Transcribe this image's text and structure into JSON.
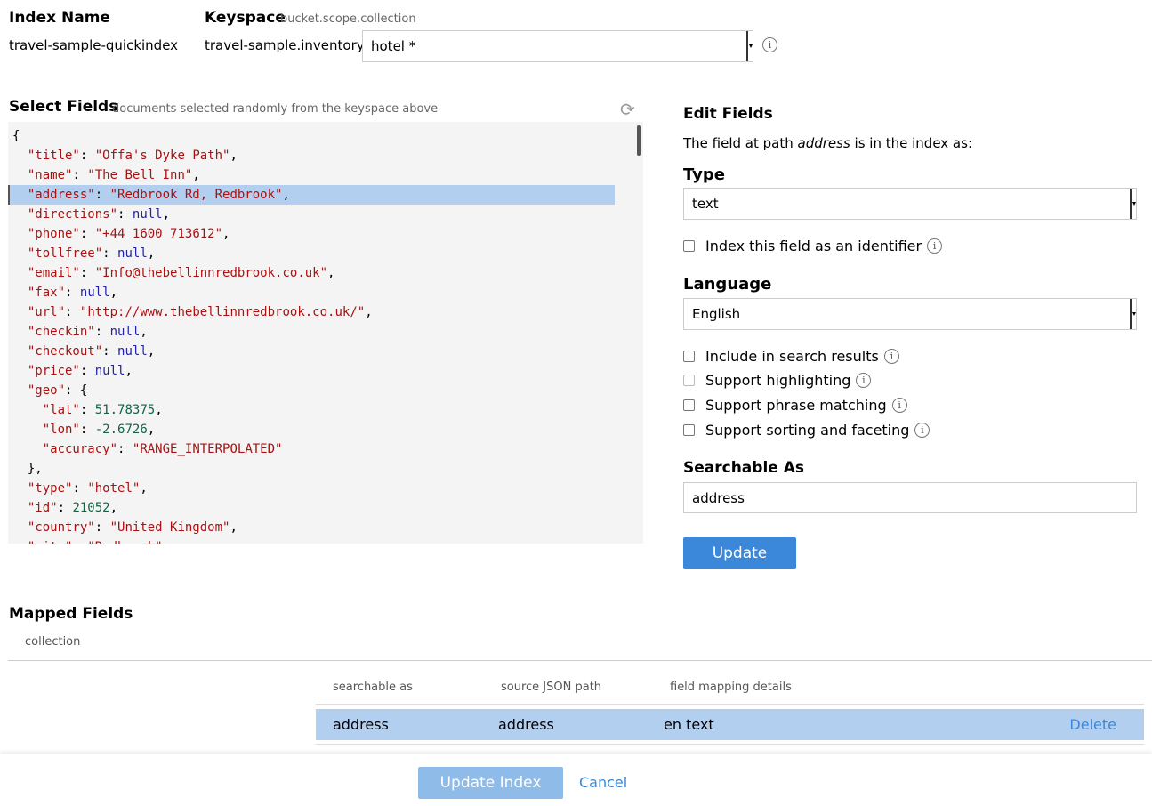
{
  "header": {
    "index_name_label": "Index Name",
    "index_name_value": "travel-sample-quickindex",
    "keyspace_label": "Keyspace",
    "keyspace_hint": "bucket.scope.collection",
    "keyspace_prefix": "travel-sample.inventory.",
    "keyspace_selected": "hotel *",
    "info_icon": "info-icon"
  },
  "select_fields": {
    "title": "Select Fields",
    "hint": "documents selected randomly from the keyspace above",
    "refresh_icon": "refresh-icon",
    "json_lines": [
      "{",
      "  \"title\": \"Offa's Dyke Path\",",
      "  \"name\": \"The Bell Inn\",",
      "  \"address\": \"Redbrook Rd, Redbrook\",",
      "  \"directions\": null,",
      "  \"phone\": \"+44 1600 713612\",",
      "  \"tollfree\": null,",
      "  \"email\": \"Info@thebellinnredbrook.co.uk\",",
      "  \"fax\": null,",
      "  \"url\": \"http://www.thebellinnredbrook.co.uk/\",",
      "  \"checkin\": null,",
      "  \"checkout\": null,",
      "  \"price\": null,",
      "  \"geo\": {",
      "    \"lat\": 51.78375,",
      "    \"lon\": -2.6726,",
      "    \"accuracy\": \"RANGE_INTERPOLATED\"",
      "  },",
      "  \"type\": \"hotel\",",
      "  \"id\": 21052,",
      "  \"country\": \"United Kingdom\",",
      "  \"city\": \"Redbrook\","
    ],
    "highlighted_line": 3
  },
  "edit_fields": {
    "title": "Edit Fields",
    "desc_prefix": "The field at path ",
    "desc_path": "address",
    "desc_suffix": " is in the index as:",
    "type_label": "Type",
    "type_value": "text",
    "identifier_label": "Index this field as an identifier",
    "language_label": "Language",
    "language_value": "English",
    "options": [
      {
        "label": "Include in search results",
        "checked": false
      },
      {
        "label": "Support highlighting",
        "checked": false
      },
      {
        "label": "Support phrase matching",
        "checked": false
      },
      {
        "label": "Support sorting and faceting",
        "checked": false
      }
    ],
    "searchable_as_label": "Searchable As",
    "searchable_as_value": "address",
    "update_button": "Update"
  },
  "mapped_fields": {
    "title": "Mapped Fields",
    "tab": "collection",
    "columns": [
      "searchable as",
      "source JSON path",
      "field mapping details"
    ],
    "rows": [
      {
        "searchable_as": "address",
        "source_path": "address",
        "details": "en text",
        "action": "Delete"
      }
    ]
  },
  "footer": {
    "update_index_button": "Update Index",
    "cancel_link": "Cancel"
  },
  "colors": {
    "accent": "#3b87d9",
    "accent_disabled": "#8fbbe8",
    "highlight": "#b3cff0",
    "json_string": "#aa1111",
    "json_number": "#116644",
    "json_null": "#2222aa"
  }
}
